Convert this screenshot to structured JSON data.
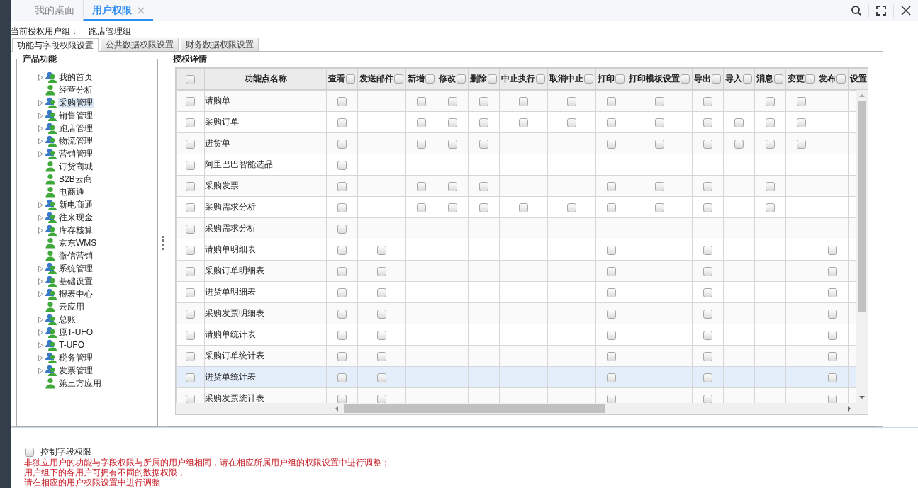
{
  "top_tabs": [
    {
      "label": "我的桌面",
      "selected": false,
      "closable": false
    },
    {
      "label": "用户权限",
      "selected": true,
      "closable": true
    }
  ],
  "group_label": "当前授权用户组：",
  "group_value": "跑店管理组",
  "sub_tabs": [
    {
      "label": "功能与字段权限设置",
      "selected": true
    },
    {
      "label": "公共数据权限设置",
      "selected": false
    },
    {
      "label": "财务数据权限设置",
      "selected": false
    }
  ],
  "tree": {
    "title": "产品功能",
    "items": [
      {
        "label": "我的首页",
        "kind": "group",
        "selected": false
      },
      {
        "label": "经营分析",
        "kind": "leaf",
        "selected": false
      },
      {
        "label": "采购管理",
        "kind": "group",
        "selected": true
      },
      {
        "label": "销售管理",
        "kind": "group",
        "selected": false
      },
      {
        "label": "跑店管理",
        "kind": "group",
        "selected": false
      },
      {
        "label": "物流管理",
        "kind": "group",
        "selected": false
      },
      {
        "label": "营销管理",
        "kind": "group",
        "selected": false
      },
      {
        "label": "订货商城",
        "kind": "leaf",
        "selected": false
      },
      {
        "label": "B2B云商",
        "kind": "leaf",
        "selected": false
      },
      {
        "label": "电商通",
        "kind": "leaf",
        "selected": false
      },
      {
        "label": "新电商通",
        "kind": "group",
        "selected": false
      },
      {
        "label": "往来现金",
        "kind": "group",
        "selected": false
      },
      {
        "label": "库存核算",
        "kind": "group",
        "selected": false
      },
      {
        "label": "京东WMS",
        "kind": "leaf",
        "selected": false
      },
      {
        "label": "微信营销",
        "kind": "leaf",
        "selected": false
      },
      {
        "label": "系统管理",
        "kind": "group",
        "selected": false
      },
      {
        "label": "基础设置",
        "kind": "group",
        "selected": false
      },
      {
        "label": "报表中心",
        "kind": "group",
        "selected": false
      },
      {
        "label": "云应用",
        "kind": "leaf",
        "selected": false
      },
      {
        "label": "总账",
        "kind": "group",
        "selected": false
      },
      {
        "label": "原T-UFO",
        "kind": "group",
        "selected": false
      },
      {
        "label": "T-UFO",
        "kind": "group",
        "selected": false
      },
      {
        "label": "税务管理",
        "kind": "group",
        "selected": false
      },
      {
        "label": "发票管理",
        "kind": "group",
        "selected": false
      },
      {
        "label": "第三方应用",
        "kind": "leaf",
        "selected": false
      }
    ]
  },
  "grid": {
    "title": "授权详情",
    "select_all_checked": false,
    "name_column": "功能点名称",
    "columns": [
      {
        "label": "查看",
        "checked": false
      },
      {
        "label": "发送邮件",
        "checked": false
      },
      {
        "label": "新增",
        "checked": false
      },
      {
        "label": "修改",
        "checked": false
      },
      {
        "label": "删除",
        "checked": false
      },
      {
        "label": "中止执行",
        "checked": false
      },
      {
        "label": "取消中止",
        "checked": false
      },
      {
        "label": "打印",
        "checked": false
      },
      {
        "label": "打印模板设置",
        "checked": false
      },
      {
        "label": "导出",
        "checked": false
      },
      {
        "label": "导入",
        "checked": false
      },
      {
        "label": "消息",
        "checked": false
      },
      {
        "label": "变更",
        "checked": false
      },
      {
        "label": "发布",
        "checked": false
      },
      {
        "label": "设置"
      }
    ],
    "rows": [
      {
        "name": "请购单",
        "checked": false,
        "selected": false,
        "cells": [
          false,
          null,
          false,
          false,
          false,
          false,
          false,
          false,
          false,
          false,
          null,
          false,
          false,
          null
        ]
      },
      {
        "name": "采购订单",
        "checked": false,
        "selected": false,
        "cells": [
          false,
          null,
          false,
          false,
          false,
          false,
          false,
          false,
          false,
          false,
          false,
          false,
          false,
          null
        ]
      },
      {
        "name": "进货单",
        "checked": false,
        "selected": false,
        "cells": [
          false,
          null,
          false,
          false,
          false,
          null,
          null,
          false,
          false,
          false,
          false,
          false,
          false,
          null
        ]
      },
      {
        "name": "阿里巴巴智能选品",
        "checked": false,
        "selected": false,
        "cells": [
          false,
          null,
          null,
          null,
          null,
          null,
          null,
          null,
          null,
          null,
          null,
          null,
          null,
          null
        ]
      },
      {
        "name": "采购发票",
        "checked": false,
        "selected": false,
        "cells": [
          false,
          null,
          false,
          false,
          false,
          null,
          null,
          false,
          false,
          false,
          null,
          false,
          null,
          null
        ]
      },
      {
        "name": "采购需求分析",
        "checked": false,
        "selected": false,
        "cells": [
          false,
          null,
          false,
          false,
          false,
          false,
          false,
          false,
          false,
          false,
          null,
          false,
          null,
          null
        ]
      },
      {
        "name": "采购需求分析",
        "checked": false,
        "selected": false,
        "cells": [
          false,
          null,
          null,
          null,
          null,
          null,
          null,
          null,
          null,
          null,
          null,
          null,
          null,
          null
        ]
      },
      {
        "name": "请购单明细表",
        "checked": false,
        "selected": false,
        "cells": [
          false,
          false,
          null,
          null,
          null,
          null,
          null,
          false,
          null,
          false,
          null,
          null,
          null,
          false
        ]
      },
      {
        "name": "采购订单明细表",
        "checked": false,
        "selected": false,
        "cells": [
          false,
          false,
          null,
          null,
          null,
          null,
          null,
          false,
          null,
          false,
          null,
          null,
          null,
          false
        ]
      },
      {
        "name": "进货单明细表",
        "checked": false,
        "selected": false,
        "cells": [
          false,
          false,
          null,
          null,
          null,
          null,
          null,
          false,
          null,
          false,
          null,
          null,
          null,
          false
        ]
      },
      {
        "name": "采购发票明细表",
        "checked": false,
        "selected": false,
        "cells": [
          false,
          false,
          null,
          null,
          null,
          null,
          null,
          false,
          null,
          false,
          null,
          null,
          null,
          false
        ]
      },
      {
        "name": "请购单统计表",
        "checked": false,
        "selected": false,
        "cells": [
          false,
          false,
          null,
          null,
          null,
          null,
          null,
          false,
          null,
          false,
          null,
          null,
          null,
          false
        ]
      },
      {
        "name": "采购订单统计表",
        "checked": false,
        "selected": false,
        "cells": [
          false,
          false,
          null,
          null,
          null,
          null,
          null,
          false,
          null,
          false,
          null,
          null,
          null,
          false
        ]
      },
      {
        "name": "进货单统计表",
        "checked": false,
        "selected": true,
        "cells": [
          false,
          false,
          null,
          null,
          null,
          null,
          null,
          false,
          null,
          false,
          null,
          null,
          null,
          false
        ]
      },
      {
        "name": "采购发票统计表",
        "checked": false,
        "selected": false,
        "cells": [
          false,
          false,
          null,
          null,
          null,
          null,
          null,
          false,
          null,
          false,
          null,
          null,
          null,
          false
        ]
      }
    ]
  },
  "field_control": {
    "label": "控制字段权限",
    "checked": false
  },
  "notes": [
    "非独立用户的功能与字段权限与所属的用户组相同，请在相应所属用户组的权限设置中进行调整；",
    "用户组下的各用户可拥有不同的数据权限，",
    "请在相应的用户权限设置中进行调整"
  ]
}
